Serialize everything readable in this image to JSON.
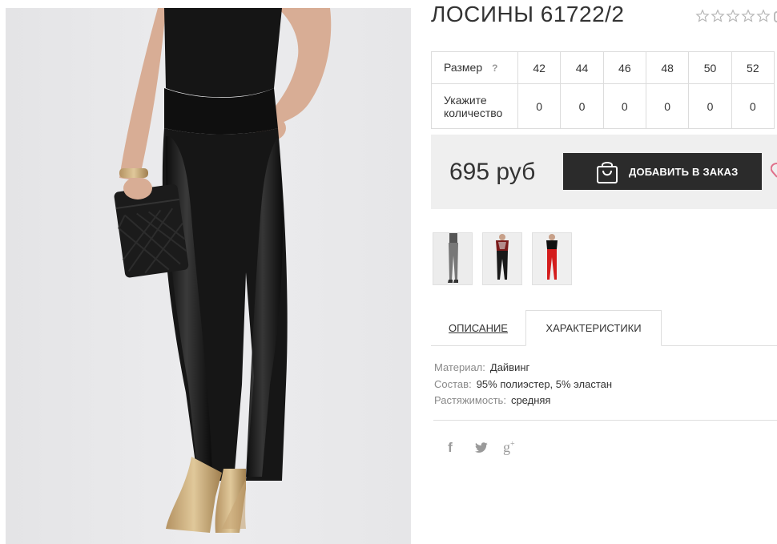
{
  "product": {
    "title": "ЛОСИНЫ 61722/2",
    "rating": {
      "value": 0,
      "max": 5
    }
  },
  "sizes_table": {
    "size_label": "Размер",
    "help_icon": "?",
    "quantity_label_line1": "Укажите",
    "quantity_label_line2": "количество",
    "sizes": [
      "42",
      "44",
      "46",
      "48",
      "50",
      "52"
    ],
    "quantities": [
      "0",
      "0",
      "0",
      "0",
      "0",
      "0"
    ]
  },
  "buy": {
    "price": "695 руб",
    "add_button_label": "ДОБАВИТЬ В ЗАКАЗ",
    "icons": {
      "bag": "shopping-bag-icon",
      "wishlist": "heart-icon"
    }
  },
  "thumbnails": [
    {
      "name": "thumb-grey-leggings"
    },
    {
      "name": "thumb-black-leggings"
    },
    {
      "name": "thumb-red-leggings"
    }
  ],
  "tabs": {
    "description": "ОПИСАНИЕ",
    "characteristics": "ХАРАКТЕРИСТИКИ",
    "active": "characteristics"
  },
  "characteristics": [
    {
      "key": "Материал:",
      "value": "Дайвинг"
    },
    {
      "key": "Состав:",
      "value": "95% полиэстер, 5% эластан"
    },
    {
      "key": "Растяжимость:",
      "value": "средняя"
    }
  ],
  "social": {
    "facebook": "f",
    "googleplus": "g",
    "googleplus_sup": "+",
    "icons": [
      "facebook-icon",
      "twitter-icon",
      "google-plus-icon"
    ]
  },
  "colors": {
    "button_bg": "#2b2b2b",
    "buybox_bg": "#efefef",
    "border": "#dcdcdc",
    "muted_text": "#8a8a8a",
    "heart": "#e0708a"
  }
}
